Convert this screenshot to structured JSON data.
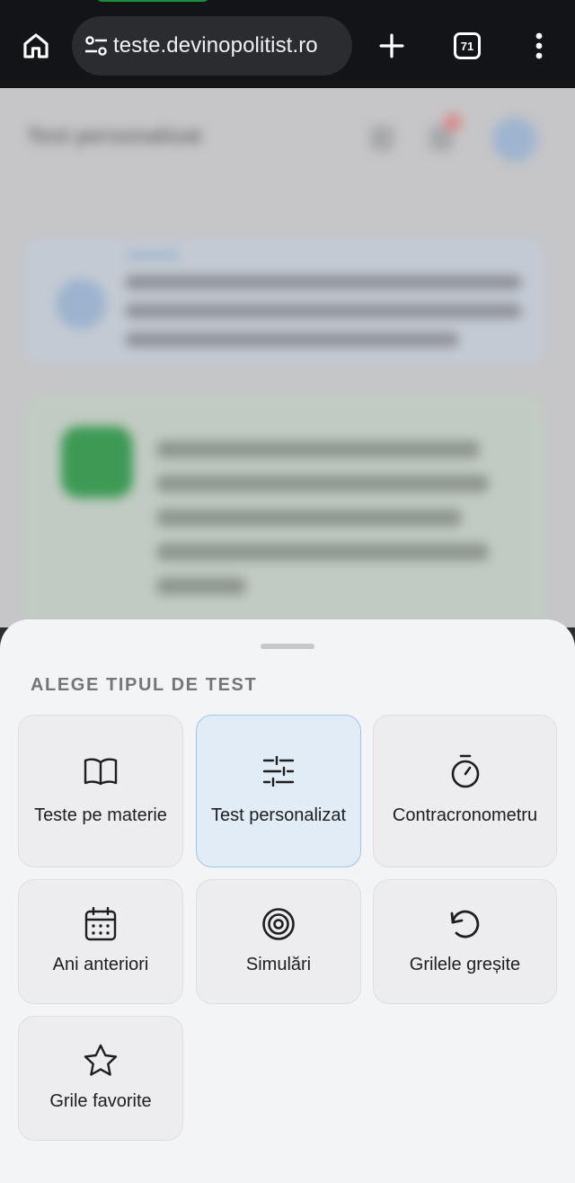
{
  "browser": {
    "url": "teste.devinopolitist.ro",
    "tab_count": "71",
    "icons": [
      "home-icon",
      "site-settings-icon",
      "new-tab-icon",
      "tab-switcher-icon",
      "more-menu-icon"
    ]
  },
  "background_page": {
    "title": "Test personalizat"
  },
  "sheet": {
    "title": "ALEGE TIPUL DE TEST",
    "options": [
      {
        "label": "Teste pe materie",
        "icon": "book-icon",
        "selected": false
      },
      {
        "label": "Test personalizat",
        "icon": "sliders-icon",
        "selected": true
      },
      {
        "label": "Contracronometru",
        "icon": "timer-icon",
        "selected": false
      },
      {
        "label": "Ani anteriori",
        "icon": "calendar-icon",
        "selected": false
      },
      {
        "label": "Simulări",
        "icon": "target-icon",
        "selected": false
      },
      {
        "label": "Grilele greșite",
        "icon": "retry-icon",
        "selected": false
      },
      {
        "label": "Grile favorite",
        "icon": "star-icon",
        "selected": false
      }
    ]
  },
  "colors": {
    "browser_bar": "#131417",
    "sheet_bg": "#f3f4f6",
    "option_bg": "#ededef",
    "selected_bg": "#e1ecf6",
    "selected_border": "#9ec4e8"
  }
}
